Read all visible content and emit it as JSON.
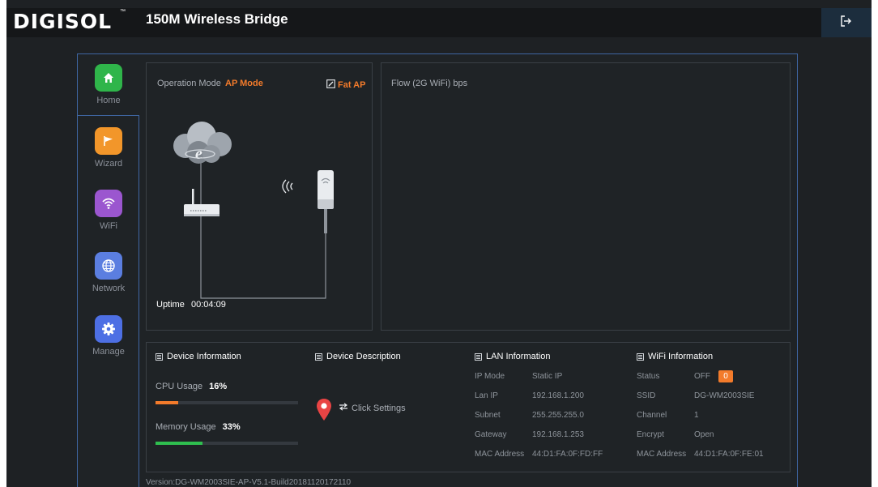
{
  "header": {
    "logo": "DIGISOL",
    "logo_tm": "™",
    "title": "150M Wireless Bridge"
  },
  "sidebar": {
    "items": [
      {
        "label": "Home"
      },
      {
        "label": "Wizard"
      },
      {
        "label": "WiFi"
      },
      {
        "label": "Network"
      },
      {
        "label": "Manage"
      }
    ]
  },
  "mode_panel": {
    "label": "Operation Mode",
    "value": "AP Mode",
    "fat_ap_label": "Fat AP",
    "uptime_label": "Uptime",
    "uptime_value": "00:04:09"
  },
  "flow_panel": {
    "title": "Flow (2G WiFi) bps"
  },
  "device_info": {
    "title": "Device Information",
    "cpu_label": "CPU Usage",
    "cpu_value": "16%",
    "cpu_fraction": 0.16,
    "memory_label": "Memory Usage",
    "memory_value": "33%",
    "memory_fraction": 0.33
  },
  "device_desc": {
    "title": "Device Description",
    "action_label": "Click Settings"
  },
  "lan_info": {
    "title": "LAN Information",
    "rows": [
      {
        "key": "IP Mode",
        "value": "Static IP"
      },
      {
        "key": "Lan IP",
        "value": "192.168.1.200"
      },
      {
        "key": "Subnet",
        "value": "255.255.255.0"
      },
      {
        "key": "Gateway",
        "value": "192.168.1.253"
      },
      {
        "key": "MAC Address",
        "value": "44:D1:FA:0F:FD:FF"
      }
    ]
  },
  "wifi_info": {
    "title": "WiFi Information",
    "status_key": "Status",
    "status_value": "OFF",
    "status_badge": "0",
    "rows": [
      {
        "key": "SSID",
        "value": "DG-WM2003SIE"
      },
      {
        "key": "Channel",
        "value": "1"
      },
      {
        "key": "Encrypt",
        "value": "Open"
      },
      {
        "key": "MAC Address",
        "value": "44:D1:FA:0F:FE:01"
      }
    ]
  },
  "footer": {
    "version": "Version:DG-WM2003SIE-AP-V5.1-Build20181120172110"
  },
  "colors": {
    "accent": "#f37b2b",
    "border_blue": "#3f66a3",
    "home_icon": "#2fb54a",
    "wizard_icon": "#f2962a",
    "wifi_icon": "#9b56cf",
    "network_icon": "#5b7ee0",
    "manage_icon": "#4d6fe4"
  }
}
